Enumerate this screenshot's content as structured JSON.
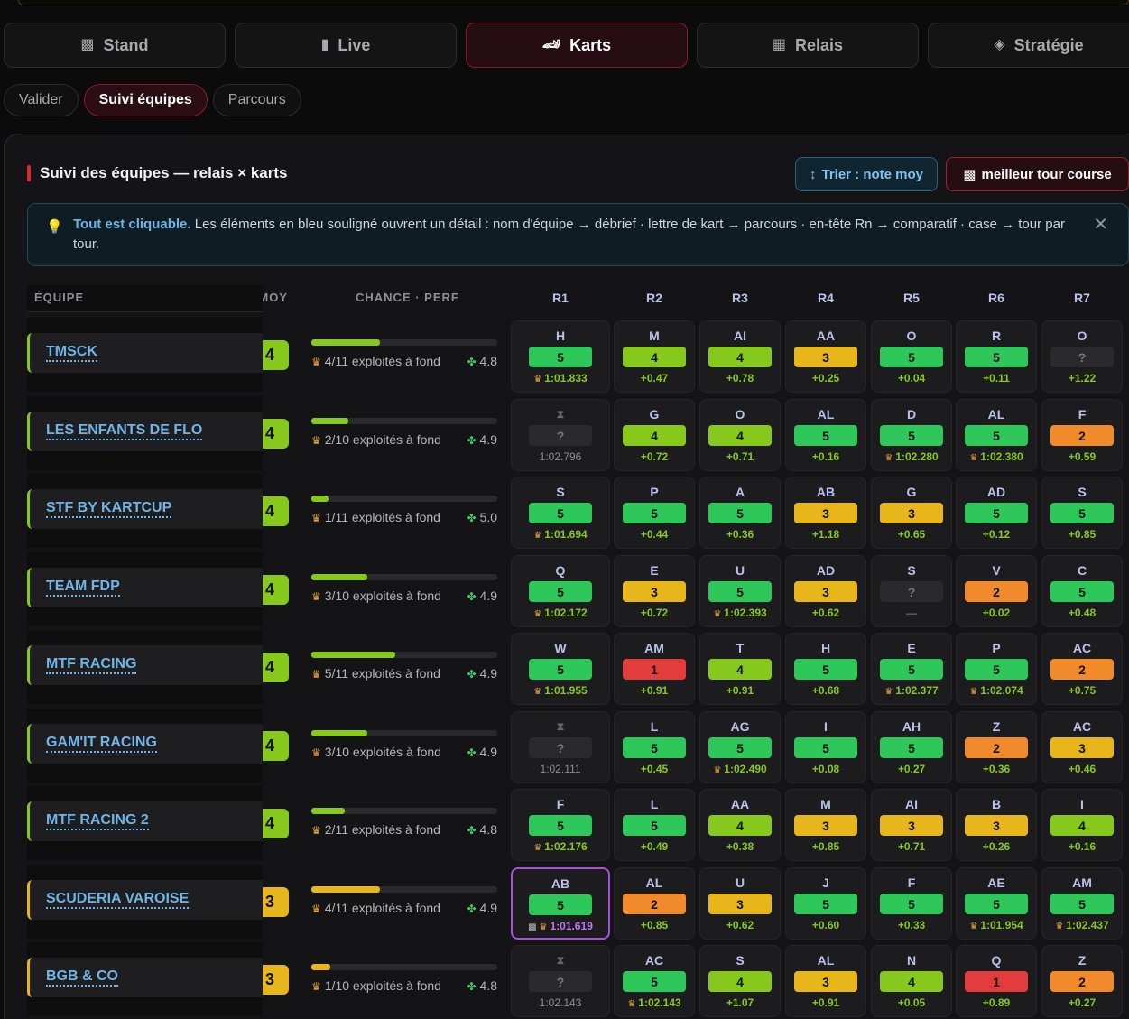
{
  "tabs": [
    {
      "label": "Stand",
      "icon": "checkered-flag-icon",
      "glyph": "▩"
    },
    {
      "label": "Live",
      "icon": "chart-icon",
      "glyph": "▮"
    },
    {
      "label": "Karts",
      "icon": "race-car-icon",
      "glyph": "🏎"
    },
    {
      "label": "Relais",
      "icon": "calendar-icon",
      "glyph": "▦"
    },
    {
      "label": "Stratégie",
      "icon": "strategy-icon",
      "glyph": "◈"
    }
  ],
  "subtabs": [
    "Valider",
    "Suivi équipes",
    "Parcours"
  ],
  "panel": {
    "title": "Suivi des équipes — relais × karts",
    "sort_button": "Trier : note moy",
    "best_button": "meilleur tour course"
  },
  "info": {
    "bold": "Tout est cliquable.",
    "text": " Les éléments en bleu souligné ouvrent un détail : nom d'équipe → débrief · lettre de kart → parcours · en-tête Rn → comparatif · case → tour par tour."
  },
  "headers": {
    "team": "ÉQUIPE",
    "moy": "MOY",
    "chance": "CHANCE · PERF",
    "relays": [
      "R1",
      "R2",
      "R3",
      "R4",
      "R5",
      "R6",
      "R7"
    ]
  },
  "teams": [
    {
      "name": "TMSCK",
      "moy": "4",
      "color": "green",
      "fill": 0.37,
      "exploited": "4/11 exploités à fond",
      "perf": "4.8",
      "cells": [
        {
          "kart": "H",
          "note": "5",
          "sub": "1:01.833",
          "crown": true
        },
        {
          "kart": "M",
          "note": "4",
          "sub": "+0.47"
        },
        {
          "kart": "AI",
          "note": "4",
          "sub": "+0.78"
        },
        {
          "kart": "AA",
          "note": "3",
          "sub": "+0.25"
        },
        {
          "kart": "O",
          "note": "5",
          "sub": "+0.04"
        },
        {
          "kart": "R",
          "note": "5",
          "sub": "+0.11"
        },
        {
          "kart": "O",
          "note": "?",
          "sub": "+1.22"
        }
      ]
    },
    {
      "name": "LES ENFANTS DE FLO",
      "moy": "4",
      "color": "green",
      "fill": 0.2,
      "exploited": "2/10 exploités à fond",
      "perf": "4.9",
      "cells": [
        {
          "kart": "⧗",
          "note": "?",
          "sub": "1:02.796",
          "grey": true
        },
        {
          "kart": "G",
          "note": "4",
          "sub": "+0.72"
        },
        {
          "kart": "O",
          "note": "4",
          "sub": "+0.71"
        },
        {
          "kart": "AL",
          "note": "5",
          "sub": "+0.16"
        },
        {
          "kart": "D",
          "note": "5",
          "sub": "1:02.280",
          "crown": true
        },
        {
          "kart": "AL",
          "note": "5",
          "sub": "1:02.380",
          "crown": true
        },
        {
          "kart": "F",
          "note": "2",
          "sub": "+0.59"
        }
      ]
    },
    {
      "name": "STF BY KARTCUP",
      "moy": "4",
      "color": "green",
      "fill": 0.09,
      "exploited": "1/11 exploités à fond",
      "perf": "5.0",
      "cells": [
        {
          "kart": "S",
          "note": "5",
          "sub": "1:01.694",
          "crown": true
        },
        {
          "kart": "P",
          "note": "5",
          "sub": "+0.44"
        },
        {
          "kart": "A",
          "note": "5",
          "sub": "+0.36"
        },
        {
          "kart": "AB",
          "note": "3",
          "sub": "+1.18"
        },
        {
          "kart": "G",
          "note": "3",
          "sub": "+0.65"
        },
        {
          "kart": "AD",
          "note": "5",
          "sub": "+0.12"
        },
        {
          "kart": "S",
          "note": "5",
          "sub": "+0.85"
        }
      ]
    },
    {
      "name": "TEAM FDP",
      "moy": "4",
      "color": "green",
      "fill": 0.3,
      "exploited": "3/10 exploités à fond",
      "perf": "4.9",
      "cells": [
        {
          "kart": "Q",
          "note": "5",
          "sub": "1:02.172",
          "crown": true
        },
        {
          "kart": "E",
          "note": "3",
          "sub": "+0.72"
        },
        {
          "kart": "U",
          "note": "5",
          "sub": "1:02.393",
          "crown": true
        },
        {
          "kart": "AD",
          "note": "3",
          "sub": "+0.62"
        },
        {
          "kart": "S",
          "note": "?",
          "sub": "—",
          "grey": true
        },
        {
          "kart": "V",
          "note": "2",
          "sub": "+0.02"
        },
        {
          "kart": "C",
          "note": "5",
          "sub": "+0.48"
        }
      ]
    },
    {
      "name": "MTF RACING",
      "moy": "4",
      "color": "green",
      "fill": 0.45,
      "exploited": "5/11 exploités à fond",
      "perf": "4.9",
      "cells": [
        {
          "kart": "W",
          "note": "5",
          "sub": "1:01.955",
          "crown": true
        },
        {
          "kart": "AM",
          "note": "1",
          "sub": "+0.91"
        },
        {
          "kart": "T",
          "note": "4",
          "sub": "+0.91"
        },
        {
          "kart": "H",
          "note": "5",
          "sub": "+0.68"
        },
        {
          "kart": "E",
          "note": "5",
          "sub": "1:02.377",
          "crown": true
        },
        {
          "kart": "P",
          "note": "5",
          "sub": "1:02.074",
          "crown": true
        },
        {
          "kart": "AC",
          "note": "2",
          "sub": "+0.75"
        }
      ]
    },
    {
      "name": "GAM'IT RACING",
      "moy": "4",
      "color": "green",
      "fill": 0.3,
      "exploited": "3/10 exploités à fond",
      "perf": "4.9",
      "cells": [
        {
          "kart": "⧗",
          "note": "?",
          "sub": "1:02.111",
          "grey": true
        },
        {
          "kart": "L",
          "note": "5",
          "sub": "+0.45"
        },
        {
          "kart": "AG",
          "note": "5",
          "sub": "1:02.490",
          "crown": true
        },
        {
          "kart": "I",
          "note": "5",
          "sub": "+0.08"
        },
        {
          "kart": "AH",
          "note": "5",
          "sub": "+0.27"
        },
        {
          "kart": "Z",
          "note": "2",
          "sub": "+0.36"
        },
        {
          "kart": "AC",
          "note": "3",
          "sub": "+0.46"
        }
      ]
    },
    {
      "name": "MTF RACING 2",
      "moy": "4",
      "color": "green",
      "fill": 0.18,
      "exploited": "2/11 exploités à fond",
      "perf": "4.8",
      "cells": [
        {
          "kart": "F",
          "note": "5",
          "sub": "1:02.176",
          "crown": true
        },
        {
          "kart": "L",
          "note": "5",
          "sub": "+0.49"
        },
        {
          "kart": "AA",
          "note": "4",
          "sub": "+0.38"
        },
        {
          "kart": "M",
          "note": "3",
          "sub": "+0.85"
        },
        {
          "kart": "AI",
          "note": "3",
          "sub": "+0.71"
        },
        {
          "kart": "B",
          "note": "3",
          "sub": "+0.26"
        },
        {
          "kart": "I",
          "note": "4",
          "sub": "+0.16"
        }
      ]
    },
    {
      "name": "SCUDERIA VAROISE",
      "moy": "3",
      "color": "yellow",
      "fill": 0.37,
      "exploited": "4/11 exploités à fond",
      "perf": "4.9",
      "cells": [
        {
          "kart": "AB",
          "note": "5",
          "sub": "1:01.619",
          "crown": true,
          "best": true
        },
        {
          "kart": "AL",
          "note": "2",
          "sub": "+0.85"
        },
        {
          "kart": "U",
          "note": "3",
          "sub": "+0.62"
        },
        {
          "kart": "J",
          "note": "5",
          "sub": "+0.60"
        },
        {
          "kart": "F",
          "note": "5",
          "sub": "+0.33"
        },
        {
          "kart": "AE",
          "note": "5",
          "sub": "1:01.954",
          "crown": true
        },
        {
          "kart": "AM",
          "note": "5",
          "sub": "1:02.437",
          "crown": true
        }
      ]
    },
    {
      "name": "BGB & CO",
      "moy": "3",
      "color": "yellow",
      "fill": 0.1,
      "exploited": "1/10 exploités à fond",
      "perf": "4.8",
      "cells": [
        {
          "kart": "⧗",
          "note": "?",
          "sub": "1:02.143",
          "grey": true
        },
        {
          "kart": "AC",
          "note": "5",
          "sub": "1:02.143",
          "crown": true
        },
        {
          "kart": "S",
          "note": "4",
          "sub": "+1.07"
        },
        {
          "kart": "AL",
          "note": "3",
          "sub": "+0.91"
        },
        {
          "kart": "N",
          "note": "4",
          "sub": "+0.05"
        },
        {
          "kart": "Q",
          "note": "1",
          "sub": "+0.89"
        },
        {
          "kart": "Z",
          "note": "2",
          "sub": "+0.27"
        }
      ]
    }
  ]
}
